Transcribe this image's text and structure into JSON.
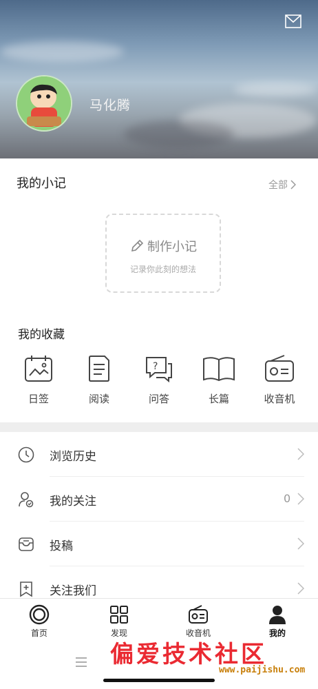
{
  "profile": {
    "name": "马化腾"
  },
  "notes": {
    "title": "我的小记",
    "all_label": "全部",
    "create_label": "制作小记",
    "create_hint": "记录你此刻的想法"
  },
  "favorites": {
    "title": "我的收藏",
    "items": [
      {
        "label": "日签",
        "icon": "calendar-icon"
      },
      {
        "label": "阅读",
        "icon": "document-icon"
      },
      {
        "label": "问答",
        "icon": "question-chat-icon"
      },
      {
        "label": "长篇",
        "icon": "book-icon"
      },
      {
        "label": "收音机",
        "icon": "radio-icon"
      }
    ]
  },
  "menu": [
    {
      "label": "浏览历史",
      "icon": "clock-icon",
      "value": ""
    },
    {
      "label": "我的关注",
      "icon": "user-follow-icon",
      "value": "0"
    },
    {
      "label": "投稿",
      "icon": "submit-icon",
      "value": ""
    },
    {
      "label": "关注我们",
      "icon": "bookmark-plus-icon",
      "value": ""
    }
  ],
  "tabbar": {
    "tabs": [
      {
        "label": "首页",
        "icon": "home-circle-icon"
      },
      {
        "label": "发现",
        "icon": "grid-icon"
      },
      {
        "label": "收音机",
        "icon": "radio-icon"
      },
      {
        "label": "我的",
        "icon": "person-icon",
        "active": true
      }
    ]
  },
  "watermark": {
    "text": "偏爱技术社区",
    "url": "www.paijishu.com"
  },
  "colors": {
    "accent": "#222222",
    "muted": "#999999",
    "divider": "#eeeeee",
    "watermark": "#e8131c"
  }
}
